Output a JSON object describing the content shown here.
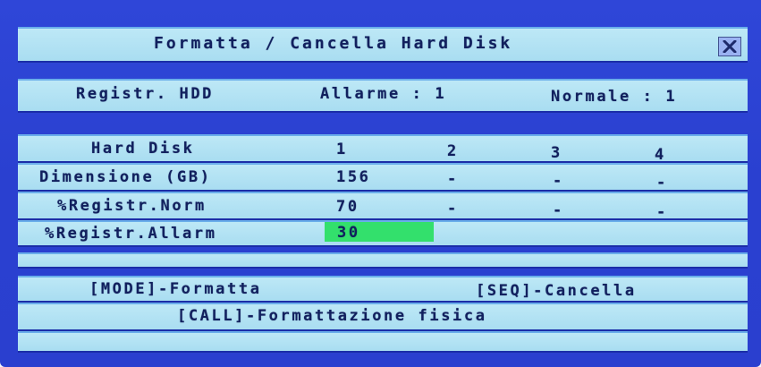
{
  "dialog": {
    "title": "Formatta / Cancella Hard Disk",
    "close_icon": "close-x-icon"
  },
  "record_status": {
    "label": "Registr. HDD",
    "alarm_label": "Allarme : 1",
    "normal_label": "Normale : 1"
  },
  "disk_table": {
    "header": {
      "label": "Hard Disk",
      "columns": [
        "1",
        "2",
        "3",
        "4"
      ]
    },
    "rows": [
      {
        "label": "Dimensione (GB)",
        "values": [
          "156",
          "-",
          "-",
          "-"
        ]
      },
      {
        "label": "%Registr.Norm",
        "values": [
          "70",
          "-",
          "-",
          "-"
        ]
      },
      {
        "label": "%Registr.Allarm",
        "values": [
          "30"
        ]
      }
    ]
  },
  "actions": {
    "format": "[MODE]-Formatta",
    "clear": "[SEQ]-Cancella",
    "physical_format": "[CALL]-Formattazione fisica"
  },
  "colors": {
    "screen_blue": "#2a40d0",
    "band_cyan": "#b5e3f4",
    "selection_green": "#33e06c",
    "text": "#11205e"
  }
}
